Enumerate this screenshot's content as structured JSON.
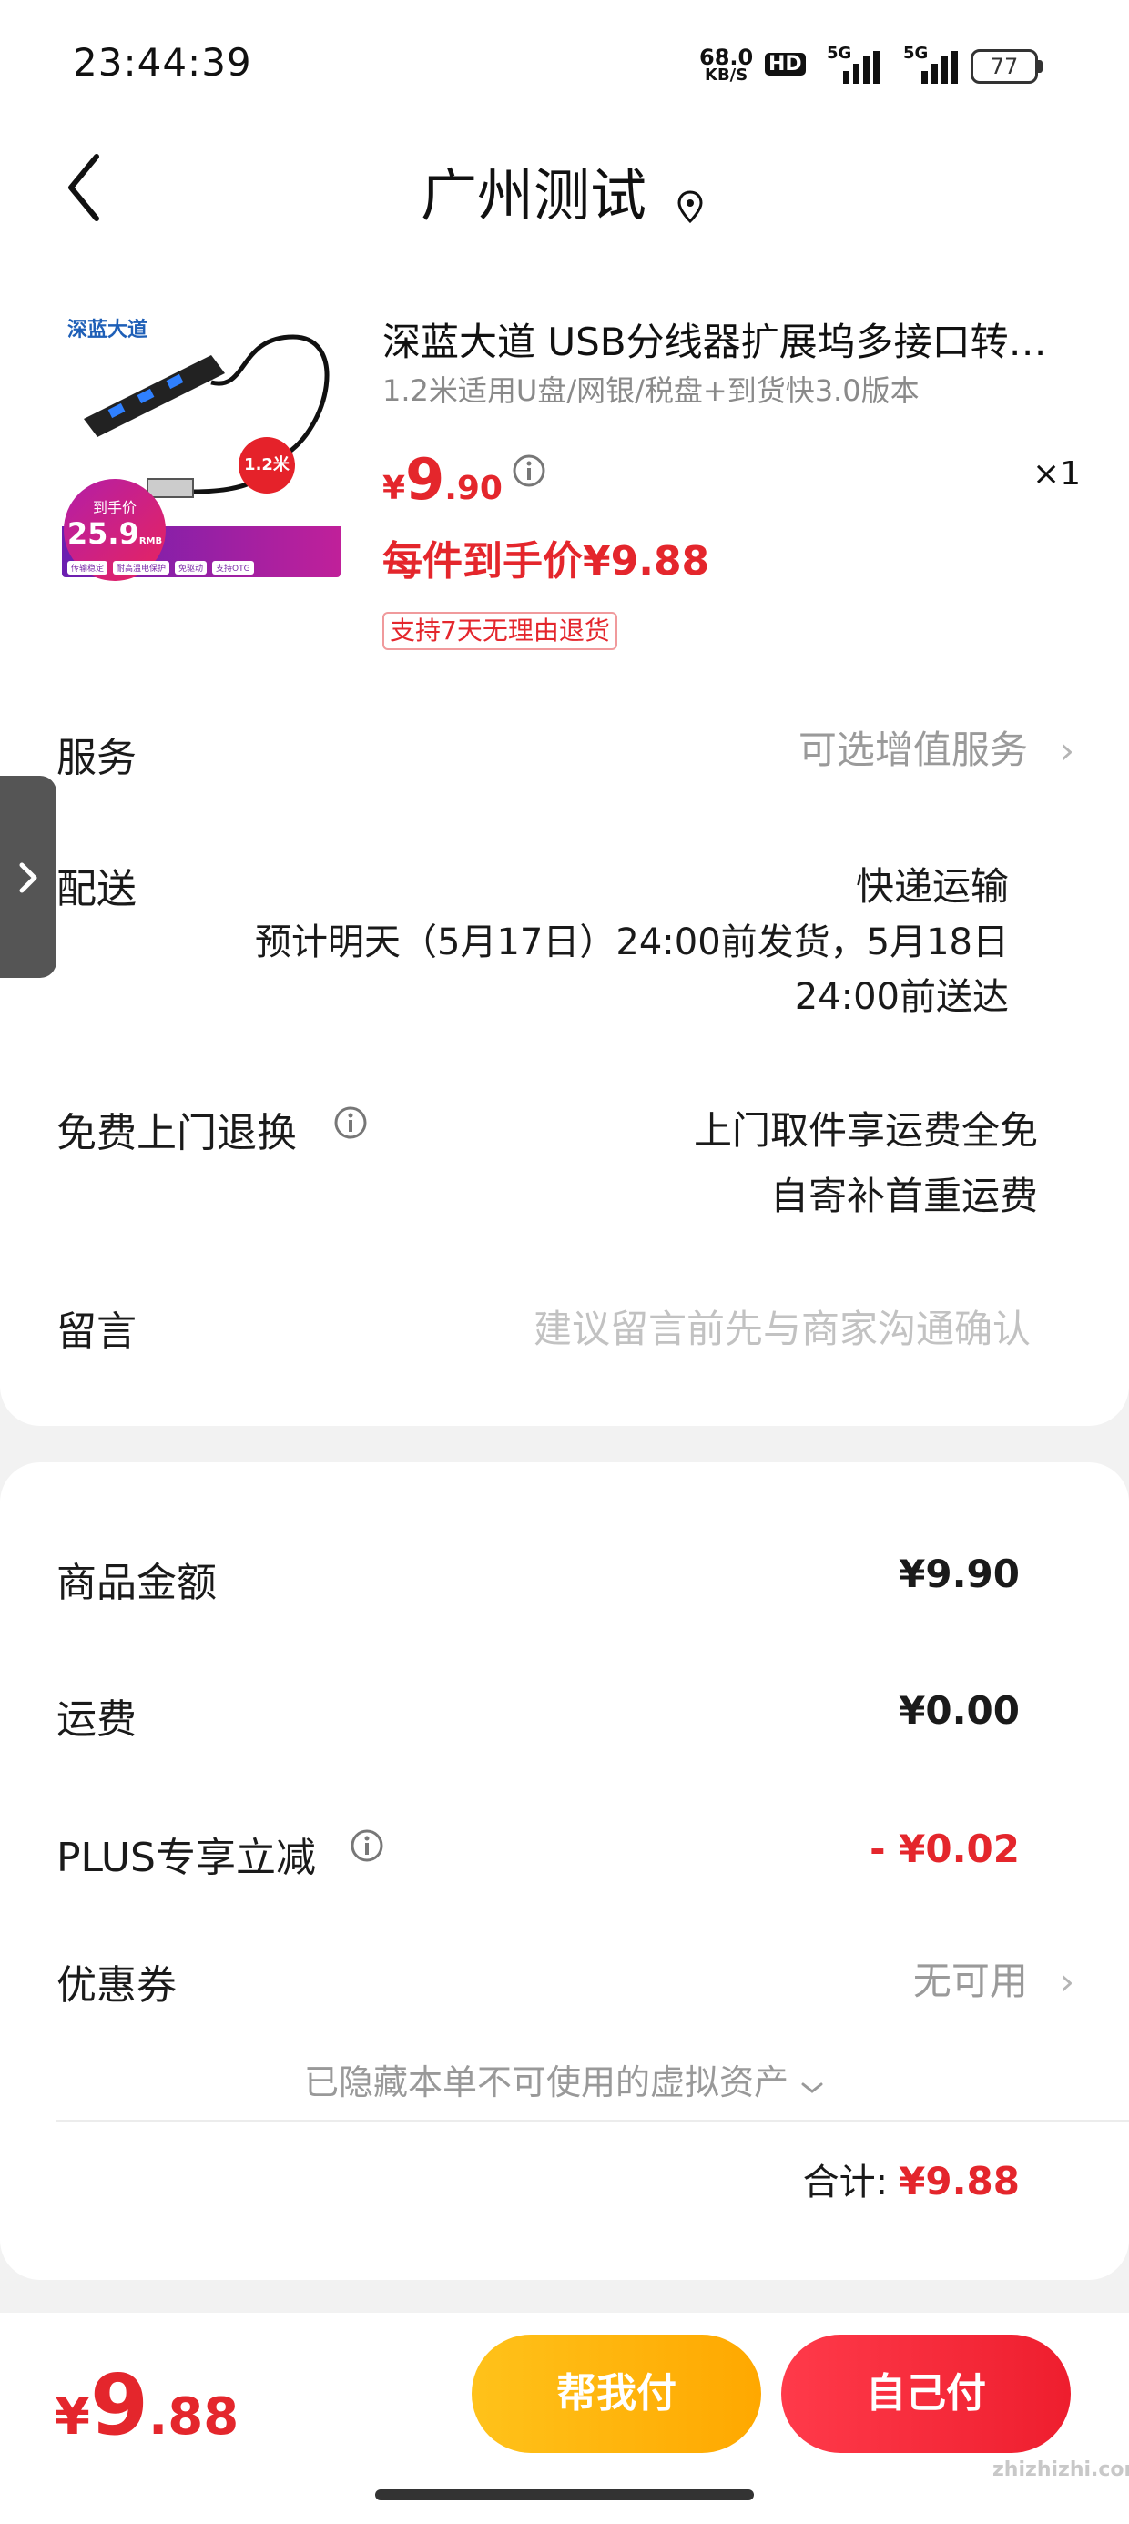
{
  "status_bar": {
    "time": "23:44:39",
    "net_speed_value": "68.0",
    "net_speed_unit": "KB/S",
    "hd_badge": "HD",
    "sim1": "5G",
    "sim2": "5G",
    "battery": "77"
  },
  "header": {
    "title": "广州测试"
  },
  "product": {
    "title": "深蓝大道 USB分线器扩展坞多接口转换器hub集线器",
    "subtitle": "1.2米适用U盘/网银/税盘+到货快3.0版本",
    "price_symbol": "¥",
    "price_int": "9",
    "price_dec": ".90",
    "quantity": "×1",
    "net_price": "每件到手价¥9.88",
    "return_policy": "支持7天无理由退货",
    "thumb_brand": "深蓝大道",
    "thumb_length": "1.2米",
    "thumb_tag": "到手价",
    "thumb_price": "25.9",
    "thumb_unit": "RMB",
    "thumb_features": [
      "传输稳定",
      "耐高温电保护",
      "免驱动",
      "支持OTG"
    ]
  },
  "service": {
    "label": "服务",
    "value": "可选增值服务"
  },
  "delivery": {
    "label": "配送",
    "method": "快递运输",
    "estimate_line1": "预计明天（5月17日）24:00前发货，5月18日",
    "estimate_line2": "24:00前送达"
  },
  "free_return": {
    "label": "免费上门退换",
    "line1": "上门取件享运费全免",
    "line2": "自寄补首重运费"
  },
  "message": {
    "label": "留言",
    "placeholder": "建议留言前先与商家沟通确认"
  },
  "summary": {
    "goods_label": "商品金额",
    "goods_value": "¥9.90",
    "shipping_label": "运费",
    "shipping_value": "¥0.00",
    "plus_label": "PLUS专享立减",
    "plus_value": "- ¥0.02",
    "coupon_label": "优惠券",
    "coupon_value": "无可用",
    "hidden_assets": "已隐藏本单不可使用的虚拟资产",
    "total_label": "合计:",
    "total_value": "¥9.88"
  },
  "bottom_bar": {
    "price_symbol": "¥",
    "price_int": "9",
    "price_dec": ".88",
    "help_pay": "帮我付",
    "self_pay": "自己付"
  },
  "watermark": "zhizhizhi.com",
  "colors": {
    "accent_red": "#e4262c",
    "help_pay_yellow": "#ffb80e",
    "self_pay_red": "#f22a3a"
  }
}
